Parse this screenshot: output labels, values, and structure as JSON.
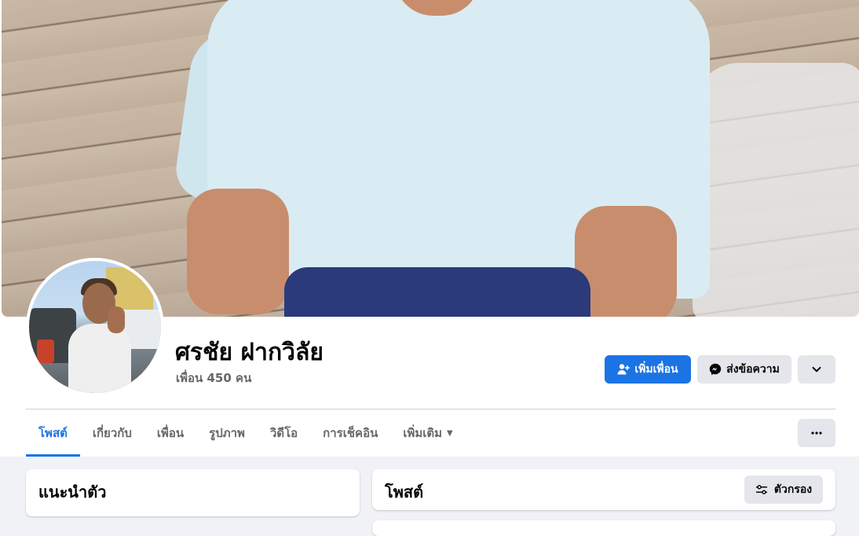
{
  "profile": {
    "name": "ศรชัย ฝากวิลัย",
    "friends_count": "เพื่อน 450 คน"
  },
  "actions": {
    "add_friend": "เพิ่มเพื่อน",
    "message": "ส่งข้อความ"
  },
  "tabs": [
    {
      "label": "โพสต์",
      "active": true
    },
    {
      "label": "เกี่ยวกับ",
      "active": false
    },
    {
      "label": "เพื่อน",
      "active": false
    },
    {
      "label": "รูปภาพ",
      "active": false
    },
    {
      "label": "วิดีโอ",
      "active": false
    },
    {
      "label": "การเช็คอิน",
      "active": false
    },
    {
      "label": "เพิ่มเติม",
      "active": false
    }
  ],
  "intro": {
    "title": "แนะนำตัว"
  },
  "posts": {
    "title": "โพสต์",
    "filter_label": "ตัวกรอง"
  },
  "colors": {
    "accent": "#1b74e4",
    "secondary_button": "#e4e6eb",
    "background": "#f0f2f5"
  },
  "icons": {
    "add_friend": "person-plus-icon",
    "message": "messenger-icon",
    "dropdown": "chevron-down-icon",
    "more": "ellipsis-icon",
    "filter": "filter-sliders-icon",
    "tab_more": "caret-down-icon"
  }
}
